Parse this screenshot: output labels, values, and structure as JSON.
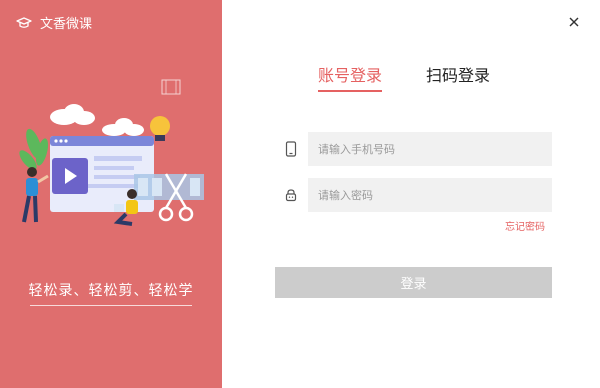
{
  "brand": {
    "name": "文香微课",
    "logo_icon": "graduation-cap-icon"
  },
  "left_panel": {
    "background": "#df6e6e",
    "slogan": "轻松录、轻松剪、轻松学"
  },
  "tabs": [
    {
      "label": "账号登录",
      "active": true
    },
    {
      "label": "扫码登录",
      "active": false
    }
  ],
  "form": {
    "phone": {
      "placeholder": "请输入手机号码",
      "value": "",
      "icon": "phone-icon"
    },
    "password": {
      "placeholder": "请输入密码",
      "value": "",
      "icon": "lock-icon"
    },
    "forgot_label": "忘记密码",
    "login_label": "登录"
  },
  "colors": {
    "accent": "#e56161",
    "button_disabled": "#cccccc",
    "input_bg": "#f1f1f1"
  }
}
